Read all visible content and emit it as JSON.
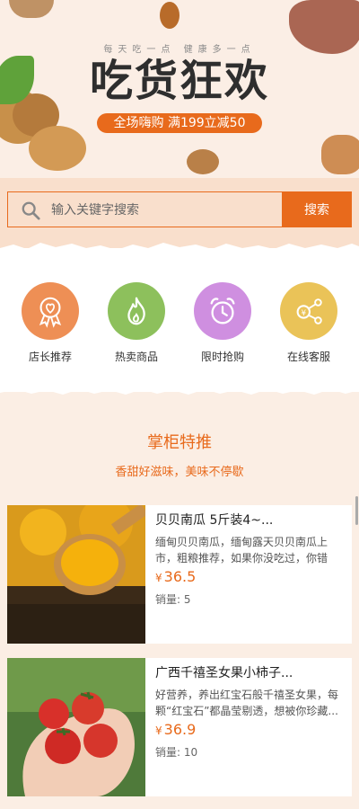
{
  "banner": {
    "slogan": "每天吃一点 健康多一点",
    "title": "吃货狂欢",
    "promo": "全场嗨购 满199立减50"
  },
  "search": {
    "placeholder": "输入关键字搜索",
    "button_label": "搜索"
  },
  "categories": [
    {
      "label": "店长推荐",
      "icon": "badge-heart-icon",
      "color": "#ee8f55"
    },
    {
      "label": "热卖商品",
      "icon": "flame-icon",
      "color": "#8dc05c"
    },
    {
      "label": "限时抢购",
      "icon": "alarm-clock-icon",
      "color": "#cf8fe0"
    },
    {
      "label": "在线客服",
      "icon": "share-nodes-icon",
      "color": "#eac358"
    }
  ],
  "section": {
    "title": "掌柜特推",
    "subtitle": "香甜好滋味，美味不停歇"
  },
  "products": [
    {
      "name": "贝贝南瓜 5斤装4~...",
      "desc": "缅甸贝贝南瓜，缅甸露天贝贝南瓜上市，粗粮推荐，如果你没吃过，你错过...",
      "currency": "¥",
      "price": "36.5",
      "sales": "销量: 5"
    },
    {
      "name": "广西千禧圣女果小柿子...",
      "desc": "好营养，养出红宝石般千禧圣女果，每颗“红宝石”都晶莹剔透，想被你珍藏...",
      "currency": "¥",
      "price": "36.9",
      "sales": "销量: 10"
    }
  ],
  "colors": {
    "accent": "#e86a1c",
    "background": "#fbeee4",
    "search_bg": "#f9dfcc"
  }
}
